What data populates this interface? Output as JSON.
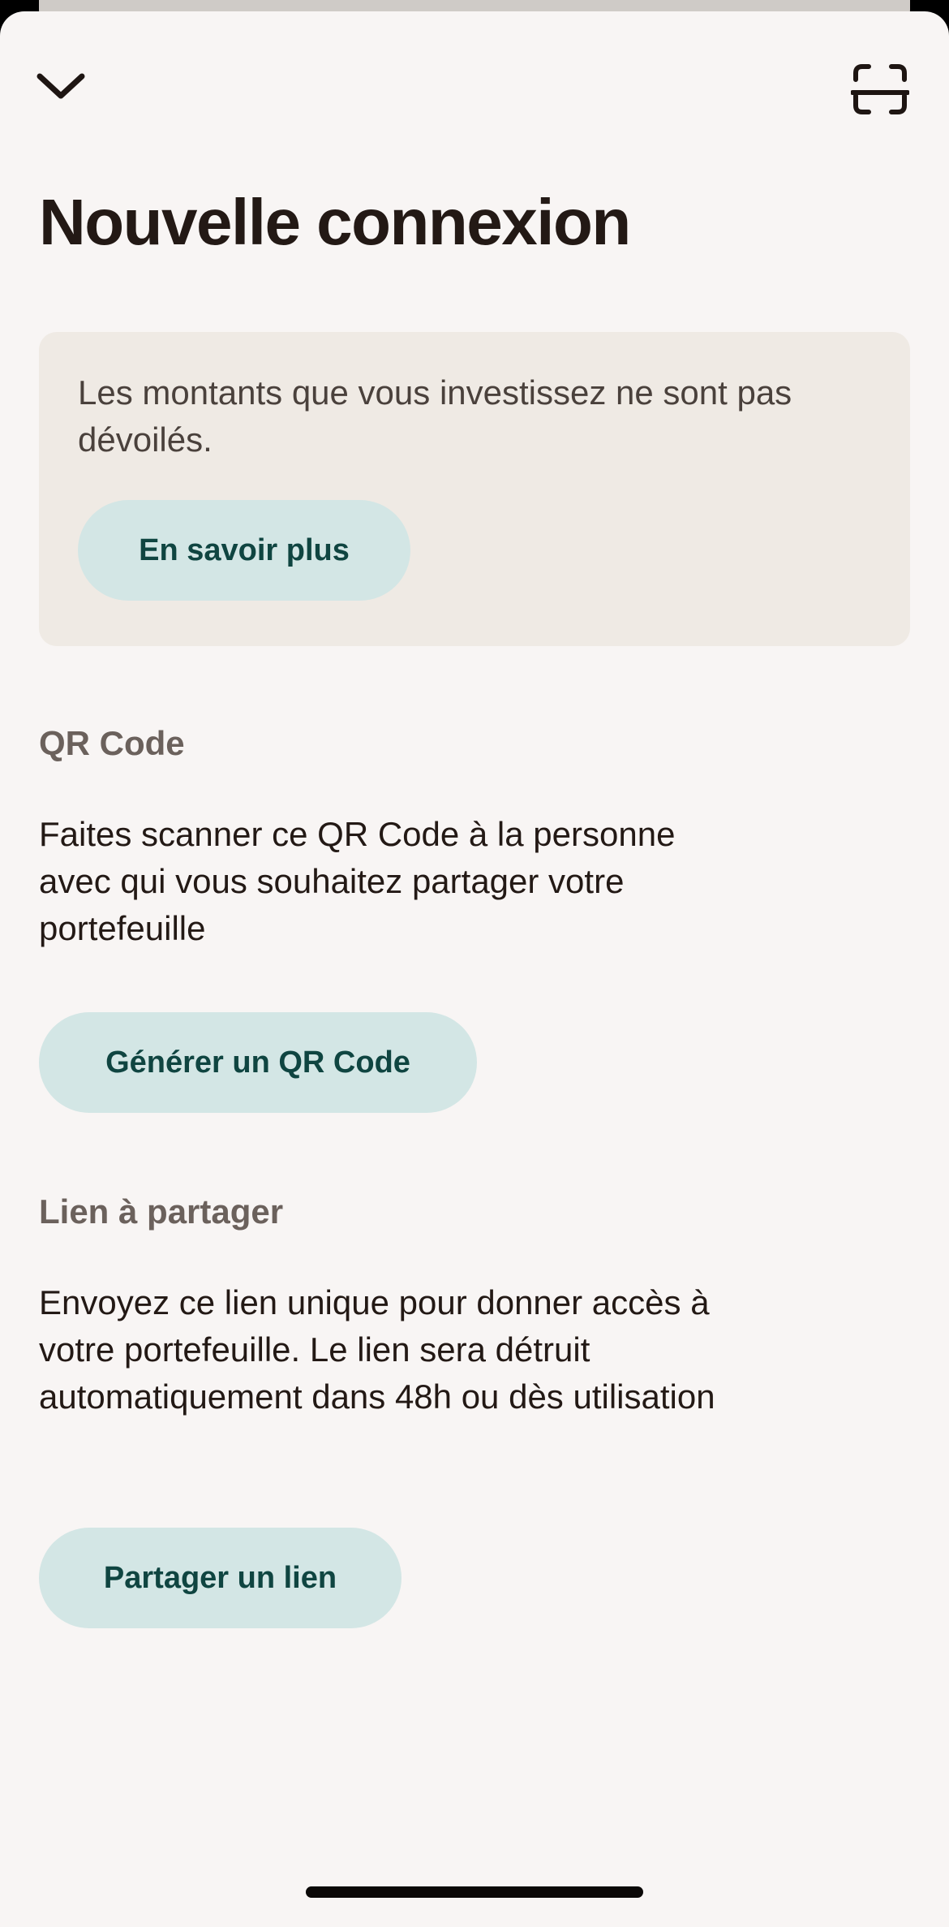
{
  "header": {
    "close_icon": "chevron-down-icon",
    "scan_icon": "scan-icon"
  },
  "page": {
    "title": "Nouvelle connexion"
  },
  "info": {
    "text": "Les montants que vous investissez ne sont pas dévoilés.",
    "button_label": "En savoir plus"
  },
  "qr_section": {
    "heading": "QR Code",
    "description": "Faites scanner ce QR Code à la personne avec qui vous souhaitez partager votre portefeuille",
    "button_label": "Générer un QR Code"
  },
  "link_section": {
    "heading": "Lien à partager",
    "description": "Envoyez ce lien unique pour donner accès à votre portefeuille. Le lien sera détruit automatiquement dans 48h ou dès utilisation",
    "button_label": "Partager un lien"
  },
  "colors": {
    "background": "#f8f5f4",
    "card": "#efeae4",
    "button_bg": "#d3e6e5",
    "button_text": "#0f4541",
    "title": "#231915",
    "heading": "#6b615c"
  }
}
